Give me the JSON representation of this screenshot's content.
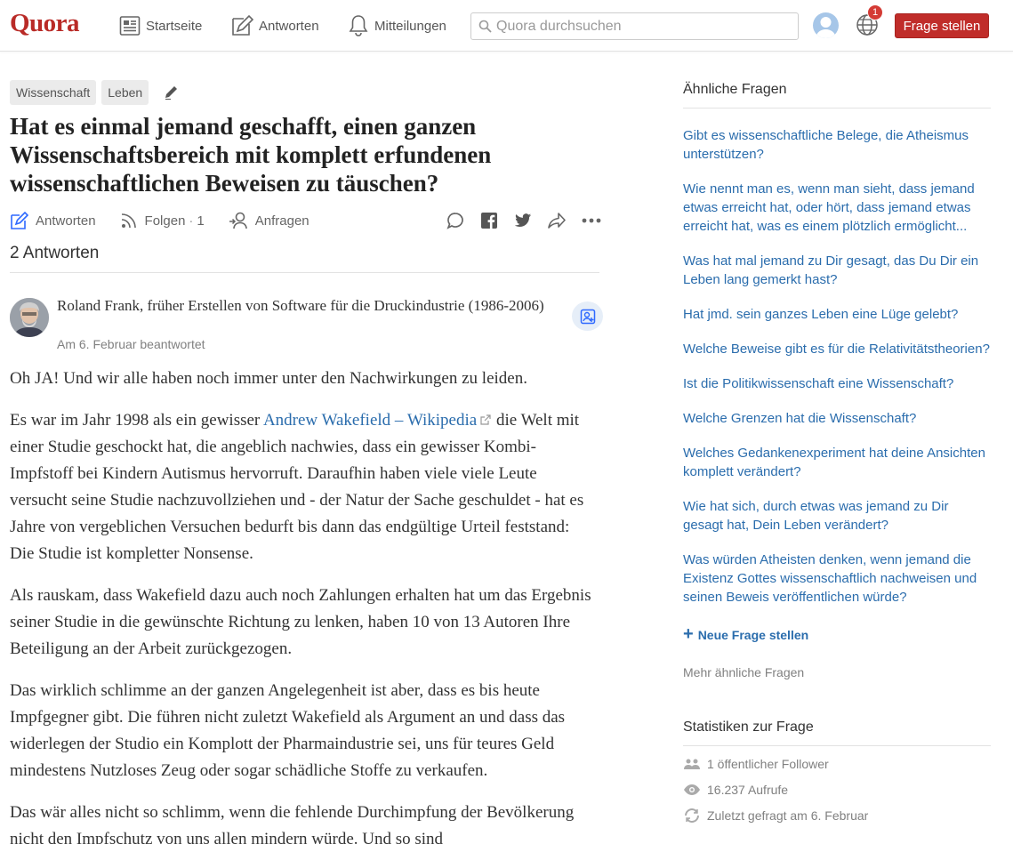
{
  "header": {
    "logo": "Quora",
    "nav": [
      "Startseite",
      "Antworten",
      "Mitteilungen"
    ],
    "search_placeholder": "Quora durchsuchen",
    "notification_count": "1",
    "ask_button": "Frage stellen"
  },
  "question": {
    "topics": [
      "Wissenschaft",
      "Leben"
    ],
    "title": "Hat es einmal jemand geschafft, einen ganzen Wissenschaftsbereich mit komplett erfundenen wissenschaftlichen Beweisen zu täuschen?",
    "actions": {
      "answer": "Antworten",
      "follow": "Folgen",
      "follow_count": "1",
      "request": "Anfragen"
    },
    "answers_count": "2 Antworten"
  },
  "answer": {
    "author_name": "Roland Frank, früher Erstellen von Software für die Druckindustrie (1986-2006)",
    "date": "Am 6. Februar beantwortet",
    "p1": "Oh JA! Und wir alle haben noch immer unter den Nachwirkungen zu leiden.",
    "p2_pre": "Es war im Jahr 1998 als ein gewisser ",
    "p2_link": "Andrew Wakefield – Wikipedia",
    "p2_post": " die Welt mit einer Studie geschockt hat, die angeblich nachwies, dass ein gewisser Kombi-Impfstoff bei Kindern Autismus hervorruft. Daraufhin haben viele viele Leute versucht seine Studie nachzuvollziehen und - der Natur der Sache geschuldet - hat es Jahre von vergeblichen Versuchen bedurft bis dann das endgültige Urteil feststand: Die Studie ist kompletter Nonsense.",
    "p3": "Als rauskam, dass Wakefield dazu auch noch Zahlungen erhalten hat um das Ergebnis seiner Studie in die gewünschte Richtung zu lenken, haben 10 von 13 Autoren Ihre Beteiligung an der Arbeit zurückgezogen.",
    "p4": "Das wirklich schlimme an der ganzen Angelegenheit ist aber, dass es bis heute Impfgegner gibt. Die führen nicht zuletzt Wakefield als Argument an und dass das widerlegen der Studio ein Komplott der Pharmaindustrie sei, uns für teures Geld mindestens Nutzloses Zeug oder sogar schädliche Stoffe zu verkaufen.",
    "p5": "Das wär alles nicht so schlimm, wenn die fehlende Durchimpfung der Bevölkerung nicht den Impfschutz von uns allen mindern würde. Und so sind"
  },
  "sidebar": {
    "related_title": "Ähnliche Fragen",
    "related": [
      "Gibt es wissenschaftliche Belege, die Atheismus unterstützen?",
      "Wie nennt man es, wenn man sieht, dass jemand etwas erreicht hat, oder hört, dass jemand etwas erreicht hat, was es einem plötzlich ermöglicht...",
      "Was hat mal jemand zu Dir gesagt, das Du Dir ein Leben lang gemerkt hast?",
      "Hat jmd. sein ganzes Leben eine Lüge gelebt?",
      "Welche Beweise gibt es für die Relativitätstheorien?",
      "Ist die Politikwissenschaft eine Wissenschaft?",
      "Welche Grenzen hat die Wissenschaft?",
      "Welches Gedankenexperiment hat deine Ansichten komplett verändert?",
      "Wie hat sich, durch etwas was jemand zu Dir gesagt hat, Dein Leben verändert?",
      "Was würden Atheisten denken, wenn jemand die Existenz Gottes wissenschaftlich nachweisen und seinen Beweis veröffentlichen würde?"
    ],
    "new_question": "Neue Frage stellen",
    "more_questions": "Mehr ähnliche Fragen",
    "stats_title": "Statistiken zur Frage",
    "stats": [
      "1 öffentlicher Follower",
      "16.237 Aufrufe",
      "Zuletzt gefragt am 6. Februar"
    ]
  }
}
